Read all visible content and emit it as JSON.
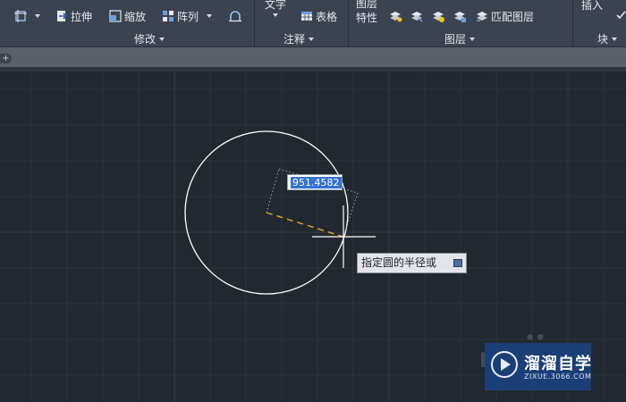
{
  "ribbon": {
    "modify": {
      "stretch_label": "拉伸",
      "scale_label": "缩放",
      "array_label": "阵列",
      "panel_title": "修改"
    },
    "annotation": {
      "text_label": "文字",
      "table_label": "表格",
      "panel_title": "注释"
    },
    "layers": {
      "properties_label_line1": "图层",
      "properties_label_line2": "特性",
      "match_layer_label": "匹配图层",
      "panel_title": "图层"
    },
    "block": {
      "insert_label": "插入",
      "panel_title": "块"
    }
  },
  "tabstrip": {
    "add_symbol": "+"
  },
  "canvas": {
    "dynamic_input_value": "951.4582",
    "prompt_tooltip": "指定圆的半径或",
    "circle_color": "#ffffff",
    "radius_line_color": "#e6a91e",
    "background_color": "#212830"
  },
  "watermark": {
    "brand_name": "溜溜自学",
    "url": "ZIXUE.3066.COM"
  }
}
